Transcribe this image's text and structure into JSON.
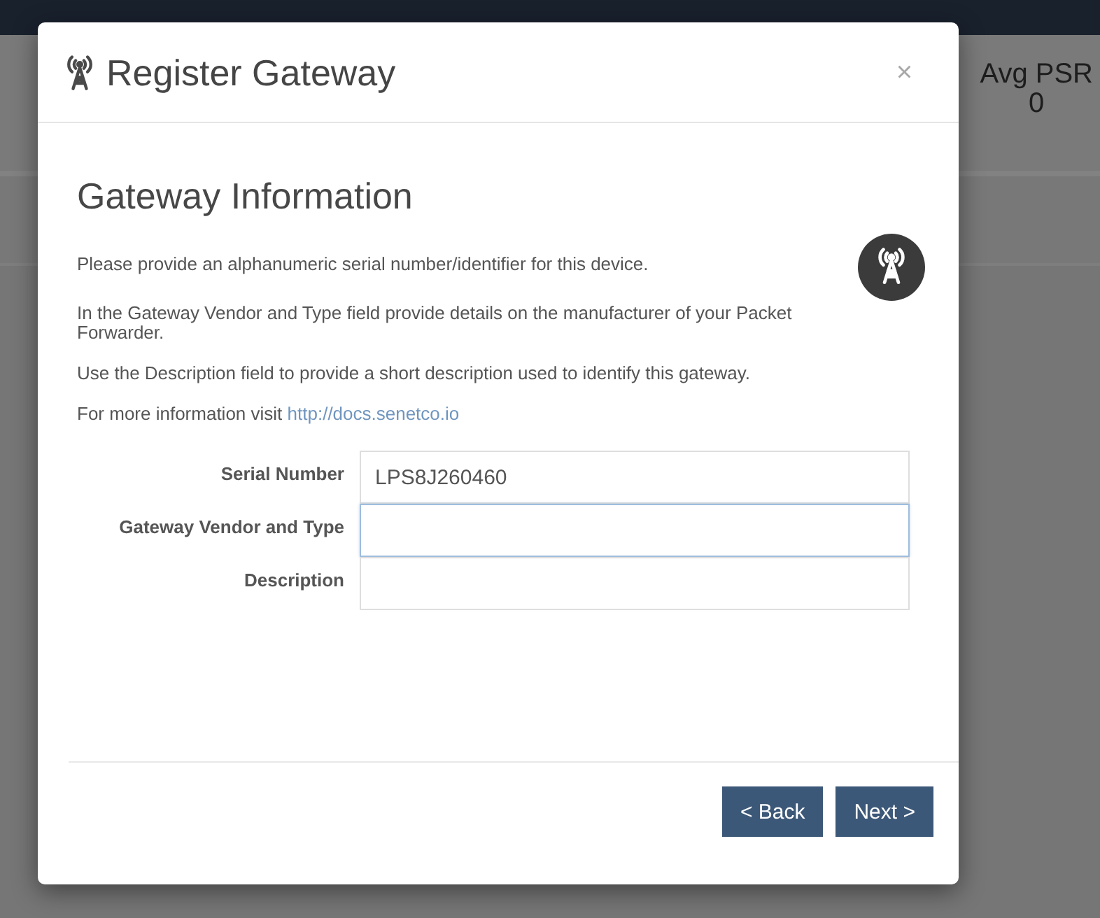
{
  "page": {
    "stat": {
      "label": "Avg PSR",
      "value": "0"
    }
  },
  "dialog": {
    "title": "Register Gateway",
    "close_symbol": "×",
    "heading": "Gateway Information",
    "paragraphs": [
      {
        "text": "Please provide an alphanumeric serial number/identifier for this device."
      },
      {
        "text": "In the Gateway Vendor and Type field provide details on the manufacturer of your Packet Forwarder."
      },
      {
        "text": "Use the Description field to provide a short description used to identify this gateway."
      },
      {
        "text": "For more information visit",
        "link": "http://docs.senetco.io"
      }
    ],
    "fields": [
      {
        "label": "Serial Number",
        "value": "LPS8J260460",
        "focused": false
      },
      {
        "label": "Gateway Vendor and Type",
        "focused": true
      },
      {
        "label": "Description",
        "focused": false
      }
    ],
    "buttons": [
      {
        "label": "< Back"
      },
      {
        "label": "Next >"
      }
    ]
  }
}
